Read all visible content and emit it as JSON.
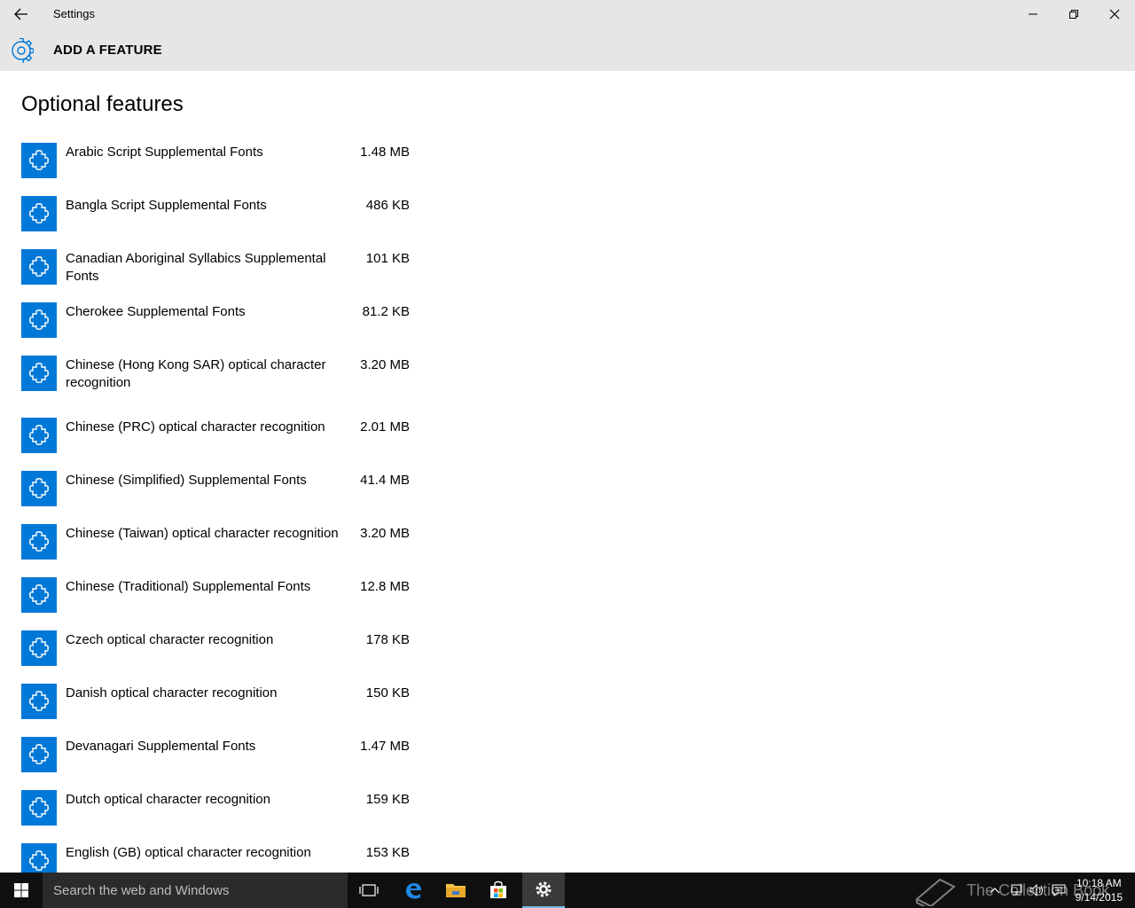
{
  "window": {
    "title": "Settings"
  },
  "header": {
    "title": "ADD A FEATURE"
  },
  "main": {
    "title": "Optional features",
    "features": [
      {
        "name": "Arabic Script Supplemental Fonts",
        "size": "1.48 MB"
      },
      {
        "name": "Bangla Script Supplemental Fonts",
        "size": "486 KB"
      },
      {
        "name": "Canadian Aboriginal Syllabics Supplemental Fonts",
        "size": "101 KB"
      },
      {
        "name": "Cherokee Supplemental Fonts",
        "size": "81.2 KB"
      },
      {
        "name": "Chinese (Hong Kong SAR) optical character recognition",
        "size": "3.20 MB"
      },
      {
        "name": "Chinese (PRC) optical character recognition",
        "size": "2.01 MB"
      },
      {
        "name": "Chinese (Simplified) Supplemental Fonts",
        "size": "41.4 MB"
      },
      {
        "name": "Chinese (Taiwan) optical character recognition",
        "size": "3.20 MB"
      },
      {
        "name": "Chinese (Traditional) Supplemental Fonts",
        "size": "12.8 MB"
      },
      {
        "name": "Czech optical character recognition",
        "size": "178 KB"
      },
      {
        "name": "Danish optical character recognition",
        "size": "150 KB"
      },
      {
        "name": "Devanagari Supplemental Fonts",
        "size": "1.47 MB"
      },
      {
        "name": "Dutch optical character recognition",
        "size": "159 KB"
      },
      {
        "name": "English (GB) optical character recognition",
        "size": "153 KB"
      }
    ]
  },
  "taskbar": {
    "search_placeholder": "Search the web and Windows",
    "time": "10:18 AM",
    "date": "9/14/2015",
    "watermark": "The Collection Book"
  },
  "colors": {
    "accent": "#0078d7",
    "titlebar": "#e6e6e6",
    "taskbar": "#101010"
  }
}
